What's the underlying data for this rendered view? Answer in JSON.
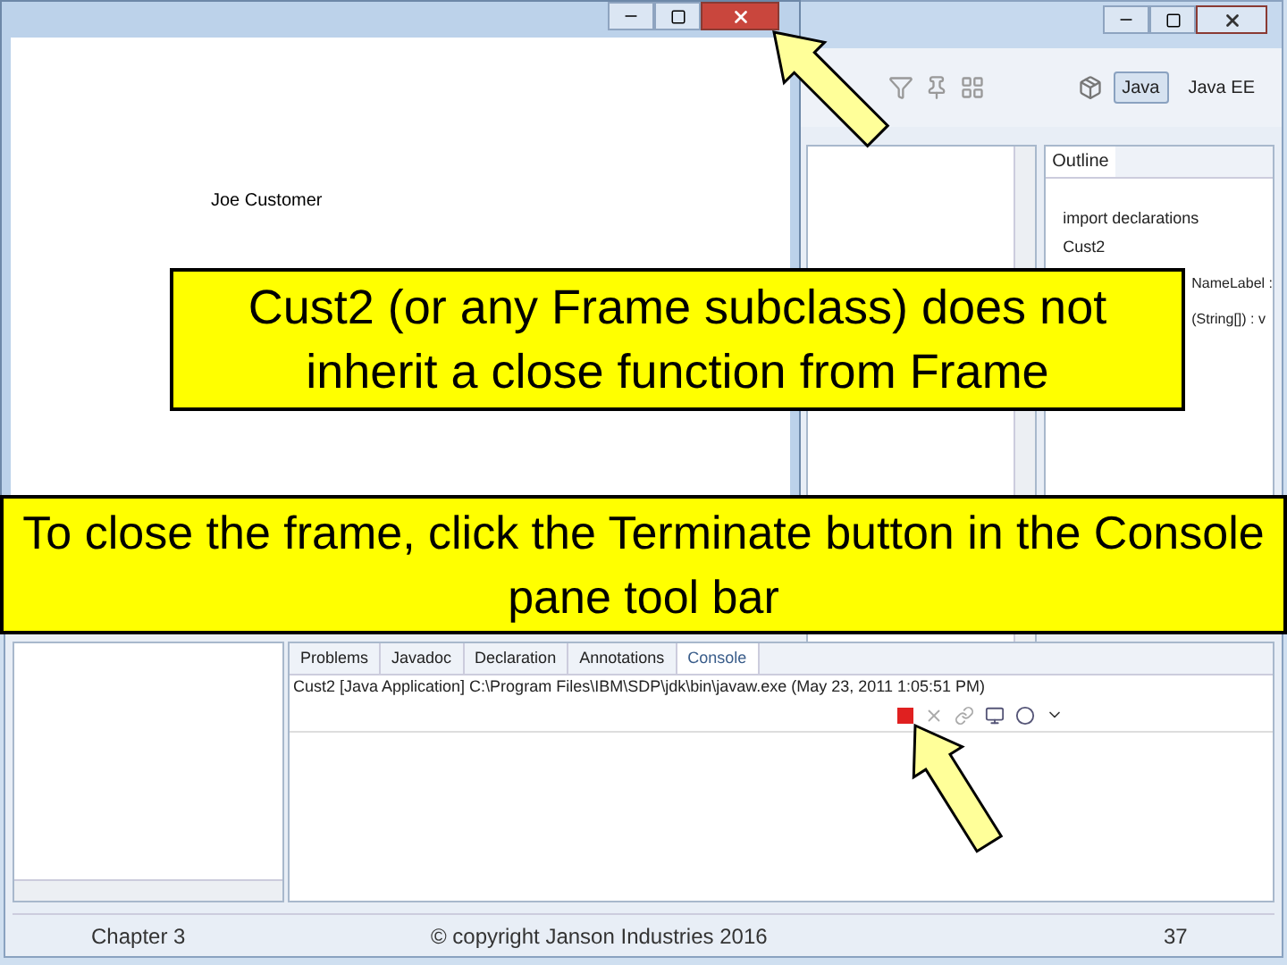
{
  "ide_window": {
    "perspectives": [
      {
        "label": "Java",
        "selected": true
      },
      {
        "label": "Java EE",
        "selected": false
      }
    ],
    "outline": {
      "tab": "Outline",
      "items": [
        {
          "label": "import declarations"
        },
        {
          "label": "Cust2",
          "children": [
            {
              "label": "NameLabel :"
            },
            {
              "label": "(String[]) : v"
            }
          ]
        }
      ]
    },
    "console": {
      "tabs": [
        {
          "label": "Problems",
          "selected": false
        },
        {
          "label": "Javadoc",
          "selected": false
        },
        {
          "label": "Declaration",
          "selected": false
        },
        {
          "label": "Annotations",
          "selected": false
        },
        {
          "label": "Console",
          "selected": true
        }
      ],
      "launch_info": "Cust2 [Java Application] C:\\Program Files\\IBM\\SDP\\jdk\\bin\\javaw.exe (May 23, 2011 1:05:51 PM)"
    }
  },
  "frame_window": {
    "label": "Joe Customer"
  },
  "callouts": [
    "Cust2 (or any Frame subclass) does not inherit a close function from Frame",
    "To close the frame, click the Terminate button in the Console pane tool bar"
  ],
  "footer": {
    "chapter": "Chapter 3",
    "copyright": "© copyright Janson Industries 2016",
    "page": "37"
  }
}
